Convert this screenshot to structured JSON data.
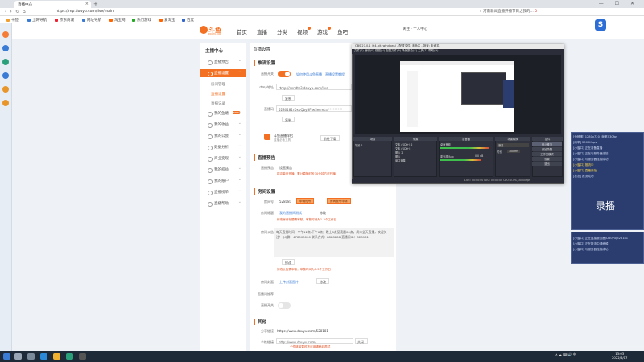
{
  "browser": {
    "tab_title": "直播中心",
    "window_controls": "— ☐ ✕",
    "url": "https://mp.douyu.com/live/main",
    "search_text": "河南新闻直播开播节目之我的...",
    "ext_count": "0"
  },
  "bookmarks": [
    {
      "label": "书签",
      "color": "#f0a030"
    },
    {
      "label": "上网导航",
      "color": "#3a7bd5"
    },
    {
      "label": "京东商城",
      "color": "#e23"
    },
    {
      "label": "网址导航",
      "color": "#3a7bd5"
    },
    {
      "label": "淘宝网",
      "color": "#f60"
    },
    {
      "label": "热门游戏",
      "color": "#2a2"
    },
    {
      "label": "爱淘宝",
      "color": "#f60"
    },
    {
      "label": "百度",
      "color": "#36c"
    }
  ],
  "site": {
    "logo_text": "斗鱼",
    "logo_sub": "DOUYU.COM",
    "nav": [
      "首页",
      "直播",
      "分类",
      "视频",
      "游戏",
      "鱼吧"
    ],
    "user": "关注 · 个人中心"
  },
  "sidebar": {
    "title": "主播中心",
    "items": [
      {
        "label": "直播预告",
        "active": false
      },
      {
        "label": "直播设置",
        "active": true
      },
      {
        "label": "房间管理",
        "sub": true
      },
      {
        "label": "直播设置",
        "sub": true,
        "on": true
      },
      {
        "label": "直播记录",
        "sub": true
      },
      {
        "label": "我的鱼塘",
        "active": false,
        "badge": "NEW"
      },
      {
        "label": "我的收益",
        "active": false
      },
      {
        "label": "我的公会",
        "active": false
      },
      {
        "label": "数据分析",
        "active": false
      },
      {
        "label": "商业变现",
        "active": false
      },
      {
        "label": "我的权益",
        "active": false
      },
      {
        "label": "我的账户",
        "active": false
      },
      {
        "label": "直播榜单",
        "active": false
      },
      {
        "label": "直播帮助",
        "active": false
      }
    ]
  },
  "main": {
    "page_title": "直播设置",
    "stream": {
      "header": "推流设置",
      "toggle_label": "直播开关",
      "link1": "如何使用斗鱼直播",
      "link2": "直播设置教程",
      "rtmp_label": "rtmp地址",
      "rtmp_value": "rtmp://sendtc3.douyu.com/live",
      "copy": "复制",
      "code_label": "直播码",
      "code_value": "5280181rDxbQbyBFfwSecret=*********",
      "mobile_title": "斗鱼直播伴侣",
      "mobile_sub": "直播必备工具",
      "download": "前往下载"
    },
    "preview": {
      "header": "直播预告",
      "label": "直播预告",
      "value": "设置预告",
      "warn": "建议单日开播，累计直播时长30分钟方可开播"
    },
    "room": {
      "header": "房间设置",
      "id_label": "房间号",
      "id_value": "528181",
      "apply_btn": "申请短号",
      "upgrade_btn": "房间靓号申请",
      "name_label": "房间标题",
      "name_value": "我的直播间测试",
      "edit": "修改",
      "name_warn": "修改房间标题需审核，审核时间为1-3个工作日",
      "notice_label": "房间公告",
      "notice_text": "每天直播时间：中午12点-下午6点；晚上8点至凌晨00点，周末全天直播，欢迎关注！QQ群：478000000  联系方式：8888888  直播间ID：528181",
      "notice_edit": "修改",
      "notice_warn": "修改公告需审核，审核时间为1-3个工作日",
      "cover_label": "房间封面",
      "cover_value": "上传封面图片",
      "cover_edit": "修改",
      "show_label": "直播间推荐",
      "show2_label": "直播开关"
    },
    "other": {
      "header": "其他",
      "share_label": "分享链接",
      "share_value": "https://www.douyu.com/528181",
      "embed_label": "个性链接",
      "embed_value": "http://www.douyu.com/",
      "embed_select": "关闭",
      "embed_warn": "个性链接暂时不可用请稍后再试"
    }
  },
  "obs": {
    "title": "OBS 27.0.1 (64-bit, windows) - 配置文件: 未命名 - 场景: 未命名",
    "menu": "文件(F)  编辑(E)  视图(V)  配置文件(P)  场景集合(S)  工具(T)  帮助(H)",
    "panels": [
      "场景",
      "来源",
      "混音器",
      "场景转换",
      "控件"
    ],
    "scene": "场景 2",
    "sources": [
      "文本 (GDI+) 2",
      "文本 (GDI+)",
      "图片 2",
      "图片",
      "窗口采集"
    ],
    "mixer": [
      "桌面音频",
      "麦克风/Aux",
      "0.0 dB"
    ],
    "transition": "渐变",
    "duration_label": "时长",
    "duration": "300 ms",
    "controls": [
      "停止推流",
      "开始录制",
      "工作室模式",
      "设置",
      "退出"
    ],
    "status": "LIVE: 00:00:00    REC: 00:00:00    CPU: 0.4%, 30.00 fps"
  },
  "rec_panel": {
    "lines": [
      "[分辨率]  1280x720  [帧率]  30fps",
      "[码率]  2500Kbps",
      "[小窗口]  正在准备直播",
      "[小窗口]  正在与服务器连接",
      "[小窗口]  与服务器连接成功",
      "[小窗口]  推流中",
      "[小窗口]  直播开始",
      "[状态]  推流成功"
    ],
    "big": "录播",
    "lines2": [
      "[小窗口]  正在连接服务器(Douyu)528181",
      "[小窗口]  正在推流中请稍候",
      "[小窗口]  与服务器连接成功"
    ]
  },
  "app_icon": "S",
  "taskbar": {
    "tray": "∧  ☁  ⌨  🔊  中",
    "time": "13:03",
    "date": "2022/6/17"
  }
}
